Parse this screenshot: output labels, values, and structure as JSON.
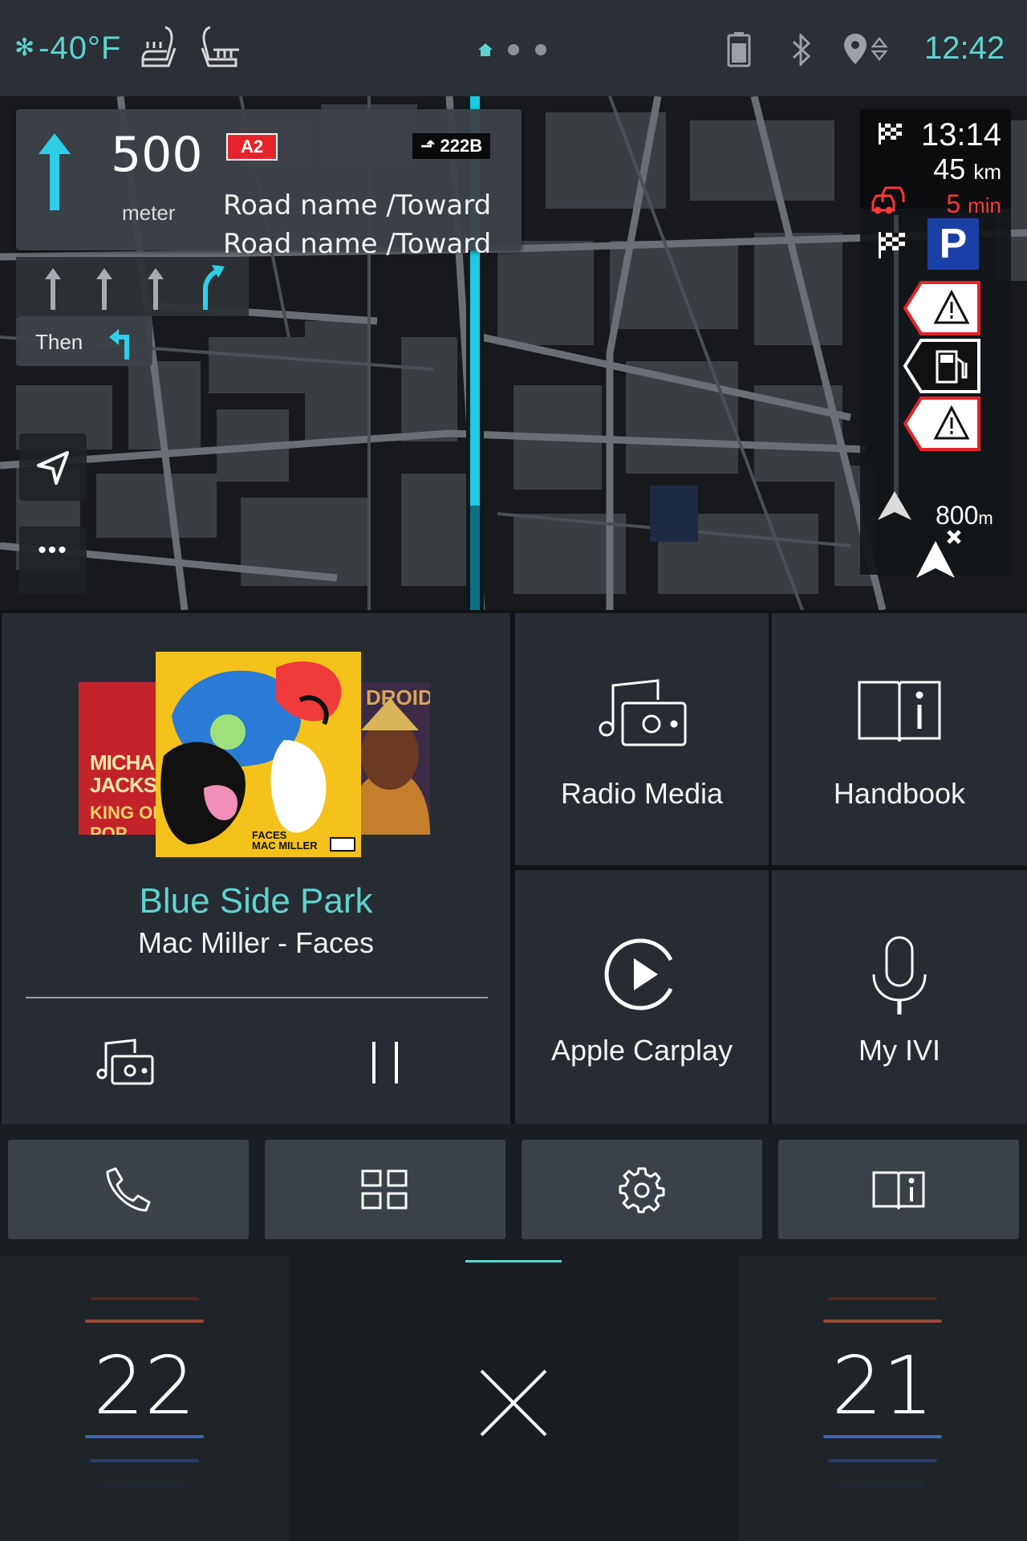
{
  "status": {
    "outside_temp": "-40°F",
    "clock": "12:42",
    "pages": 3,
    "active_page": 0
  },
  "navigation": {
    "distance": "500",
    "distance_unit": "meter",
    "road_badge": "A2",
    "exit_badge": "222B",
    "road_line1": "Road name /Toward",
    "road_line2": "Road name /Toward",
    "then_label": "Then",
    "more_label": "•••",
    "eta_time": "13:14",
    "eta_km_value": "45",
    "eta_km_unit": "km",
    "delay_value": "5",
    "delay_unit": "min",
    "next_alert_value": "800",
    "next_alert_unit": "m"
  },
  "media": {
    "title": "Blue Side Park",
    "artist_album": "Mac Miller - Faces",
    "cover_left_text": "MICHAEL JACKSON",
    "cover_left_sub": "KING OF POP",
    "cover_right_text": "DROID",
    "cover_main_text": "FACES",
    "cover_main_sub": "MAC MILLER"
  },
  "tiles": [
    {
      "label": "Radio Media"
    },
    {
      "label": "Handbook"
    },
    {
      "label": "Apple Carplay"
    },
    {
      "label": "My IVI"
    }
  ],
  "climate": {
    "left_temp": "22",
    "right_temp": "21"
  },
  "colors": {
    "accent": "#5fd3d0",
    "alert": "#ff3838",
    "tile_bg": "#262c31"
  }
}
